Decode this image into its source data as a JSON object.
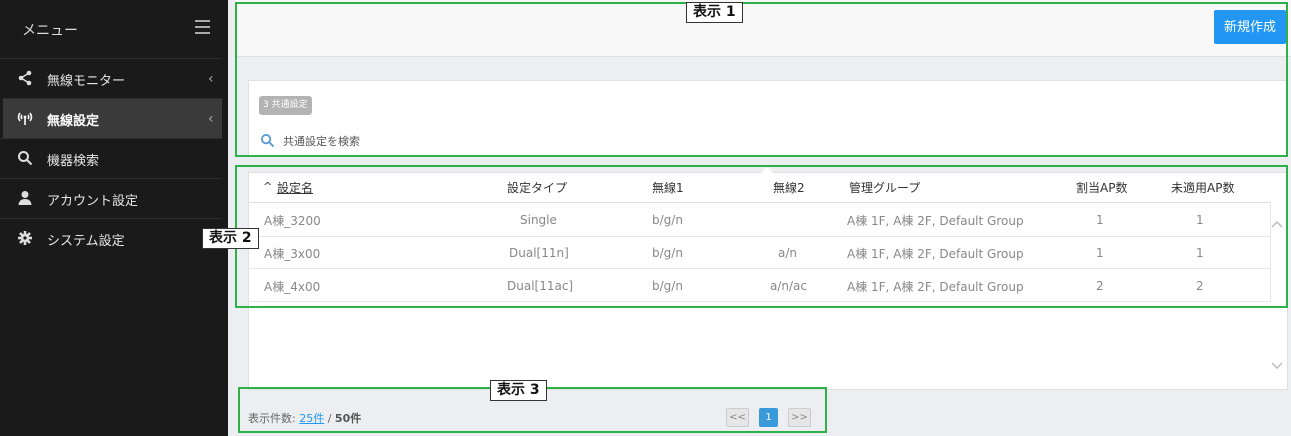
{
  "sidebar": {
    "menu_label": "メニュー",
    "items": [
      {
        "label": "無線モニター",
        "icon": "share-icon",
        "chevron": "‹"
      },
      {
        "label": "無線設定",
        "icon": "wireless-icon",
        "chevron": "‹",
        "active": true
      },
      {
        "label": "機器検索",
        "icon": "search-icon"
      },
      {
        "label": "アカウント設定",
        "icon": "user-icon"
      },
      {
        "label": "システム設定",
        "icon": "gear-icon"
      }
    ]
  },
  "toolbar": {
    "new_label": "新規作成"
  },
  "panel": {
    "badge": "3 共通設定",
    "search_placeholder": "共通設定を検索"
  },
  "table": {
    "sort_arrow": "^",
    "headers": [
      "設定名",
      "設定タイプ",
      "無線1",
      "無線2",
      "管理グループ",
      "割当AP数",
      "未適用AP数"
    ],
    "rows": [
      {
        "name": "A棟_3200",
        "type": "Single",
        "radio1": "b/g/n",
        "radio2": "",
        "groups": "A棟 1F, A棟 2F, Default Group",
        "assigned": "1",
        "unapplied": "1"
      },
      {
        "name": "A棟_3x00",
        "type": "Dual[11n]",
        "radio1": "b/g/n",
        "radio2": "a/n",
        "groups": "A棟 1F, A棟 2F, Default Group",
        "assigned": "1",
        "unapplied": "1"
      },
      {
        "name": "A棟_4x00",
        "type": "Dual[11ac]",
        "radio1": "b/g/n",
        "radio2": "a/n/ac",
        "groups": "A棟 1F, A棟 2F, Default Group",
        "assigned": "2",
        "unapplied": "2"
      }
    ]
  },
  "footer": {
    "label": "表示件数:",
    "per_page": "25件",
    "separator": " / ",
    "total": "50件"
  },
  "pagination": {
    "prev": "<<",
    "current": "1",
    "next": ">>"
  },
  "annotations": [
    "表示 1",
    "表示 2",
    "表示 3"
  ],
  "colors": {
    "accent": "#2196f3",
    "annotation": "#2db24a",
    "sidebar": "#1a1a1a"
  }
}
